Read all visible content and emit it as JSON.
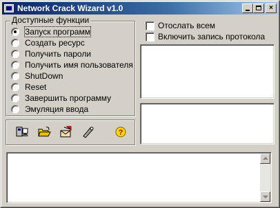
{
  "window": {
    "title": "Network Crack Wizard v1.0",
    "controls": {
      "minimize": "_",
      "maximize": "□",
      "close": "×"
    }
  },
  "functions_group": {
    "legend": "Доступные функции",
    "options": [
      {
        "label": "Запуск программ",
        "checked": true
      },
      {
        "label": "Создать ресурс",
        "checked": false
      },
      {
        "label": "Получить пароли",
        "checked": false
      },
      {
        "label": "Получить имя пользователя",
        "checked": false
      },
      {
        "label": "ShutDown",
        "checked": false
      },
      {
        "label": "Reset",
        "checked": false
      },
      {
        "label": "Завершить программу",
        "checked": false
      },
      {
        "label": "Эмуляция ввода",
        "checked": false
      }
    ]
  },
  "options": {
    "send_all": {
      "label": "Отослать всем",
      "checked": false
    },
    "enable_log": {
      "label": "Включить запись протокола",
      "checked": false
    }
  },
  "toolbar": {
    "icons": [
      "computer-icon",
      "open-folder-icon",
      "send-mail-icon",
      "tools-icon",
      "help-icon"
    ]
  },
  "colors": {
    "title_start": "#0a246a",
    "title_end": "#a6caf0",
    "face": "#d4d0c8",
    "help_yellow": "#ffd800"
  }
}
